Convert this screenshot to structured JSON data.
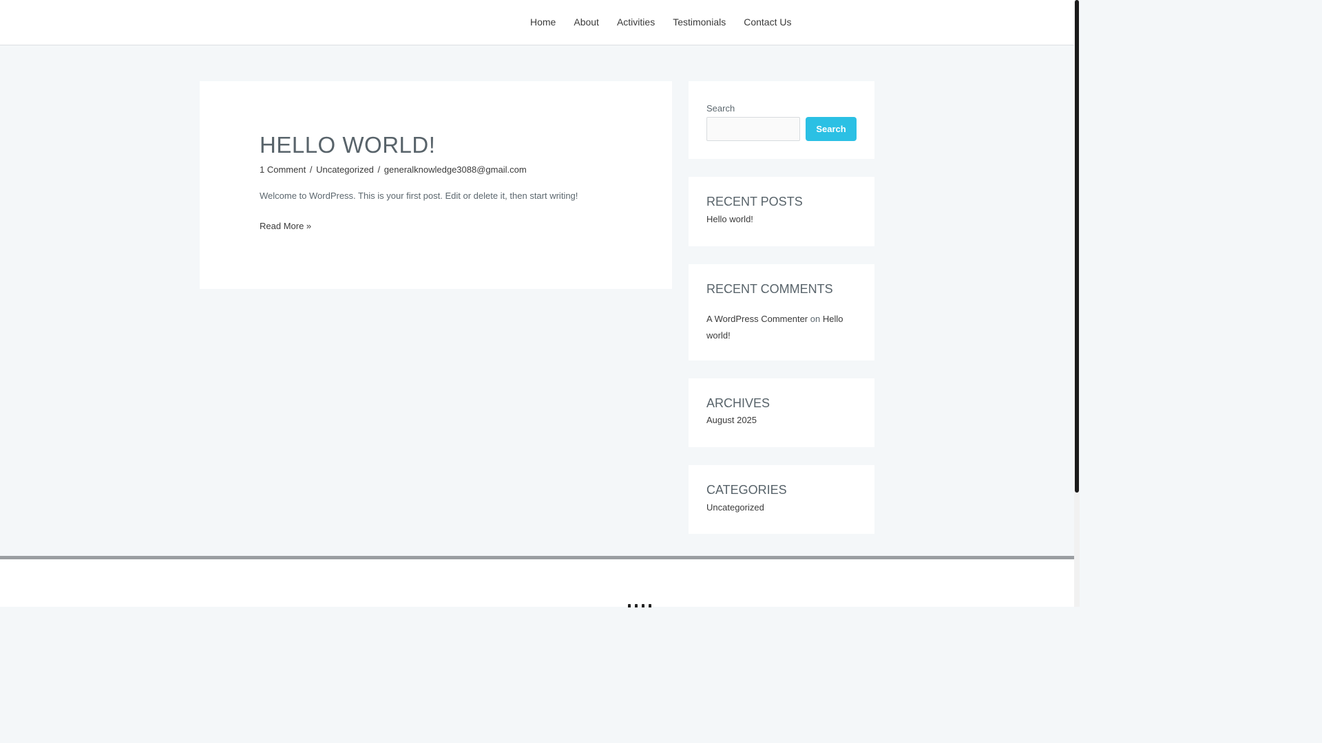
{
  "nav": {
    "items": [
      {
        "label": "Home"
      },
      {
        "label": "About"
      },
      {
        "label": "Activities"
      },
      {
        "label": "Testimonials"
      },
      {
        "label": "Contact Us"
      }
    ]
  },
  "post": {
    "title": "HELLO WORLD!",
    "comments": "1 Comment",
    "category": "Uncategorized",
    "author": "generalknowledge3088@gmail.com",
    "separator": "/",
    "excerpt": "Welcome to WordPress. This is your first post. Edit or delete it, then start writing!",
    "read_more": "Read More »"
  },
  "sidebar": {
    "search": {
      "label": "Search",
      "value": "",
      "button": "Search"
    },
    "recent_posts": {
      "title": "RECENT POSTS",
      "items": [
        "Hello world!"
      ]
    },
    "recent_comments": {
      "title": "RECENT COMMENTS",
      "author": "A WordPress Commenter",
      "connector": "on",
      "post": "Hello world!"
    },
    "archives": {
      "title": "ARCHIVES",
      "items": [
        "August 2025"
      ]
    },
    "categories": {
      "title": "CATEGORIES",
      "items": [
        "Uncategorized"
      ]
    }
  },
  "colors": {
    "accent": "#2bc0e4",
    "page_background": "#f4f7f9",
    "heading": "#58636a"
  }
}
